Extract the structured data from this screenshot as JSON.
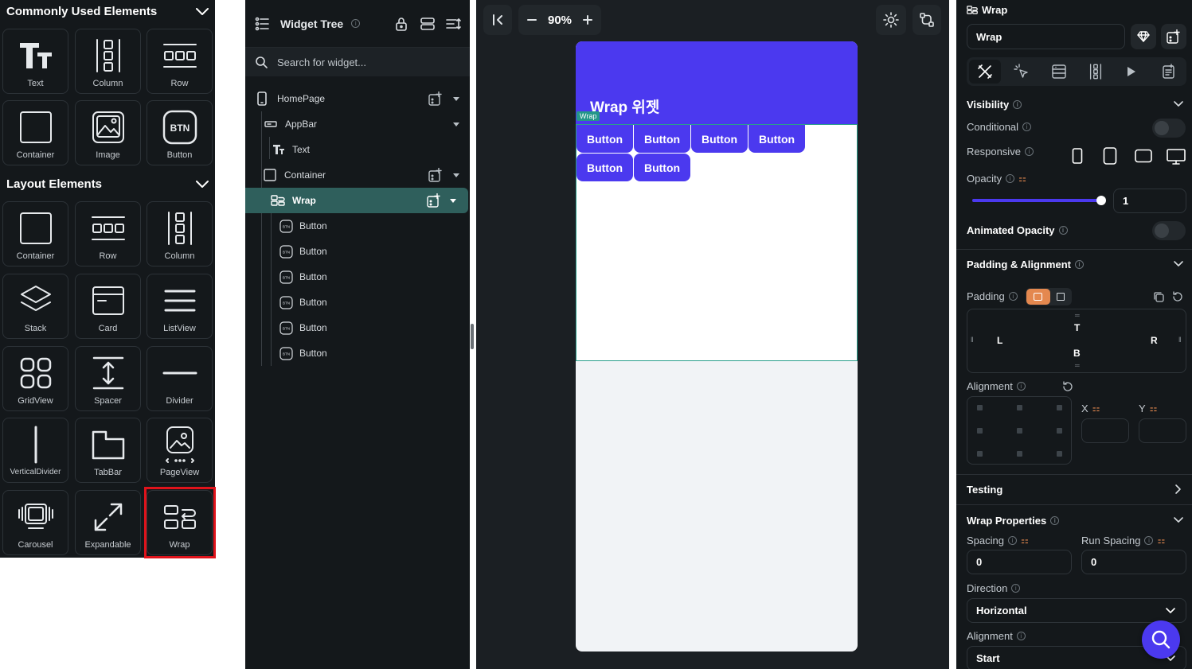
{
  "palette": {
    "common_title": "Commonly Used Elements",
    "layout_title": "Layout Elements",
    "common_items": [
      {
        "label": "Text",
        "icon": "text-icon"
      },
      {
        "label": "Column",
        "icon": "column-icon"
      },
      {
        "label": "Row",
        "icon": "row-icon"
      },
      {
        "label": "Container",
        "icon": "container-icon"
      },
      {
        "label": "Image",
        "icon": "image-icon"
      },
      {
        "label": "Button",
        "icon": "button-icon",
        "badge": "BTN"
      }
    ],
    "layout_items": [
      {
        "label": "Container",
        "icon": "container-icon"
      },
      {
        "label": "Row",
        "icon": "row-icon"
      },
      {
        "label": "Column",
        "icon": "column-icon"
      },
      {
        "label": "Stack",
        "icon": "stack-icon"
      },
      {
        "label": "Card",
        "icon": "card-icon"
      },
      {
        "label": "ListView",
        "icon": "listview-icon"
      },
      {
        "label": "GridView",
        "icon": "gridview-icon"
      },
      {
        "label": "Spacer",
        "icon": "spacer-icon"
      },
      {
        "label": "Divider",
        "icon": "divider-icon"
      },
      {
        "label": "VerticalDivider",
        "icon": "vertical-divider-icon"
      },
      {
        "label": "TabBar",
        "icon": "tabbar-icon"
      },
      {
        "label": "PageView",
        "icon": "pageview-icon"
      },
      {
        "label": "Carousel",
        "icon": "carousel-icon"
      },
      {
        "label": "Expandable",
        "icon": "expandable-icon"
      },
      {
        "label": "Wrap",
        "icon": "wrap-icon"
      }
    ],
    "highlight_color": "#e0131b"
  },
  "tree": {
    "title": "Widget Tree",
    "search_placeholder": "Search for widget...",
    "nodes": [
      {
        "label": "HomePage",
        "icon": "phone-icon"
      },
      {
        "label": "AppBar",
        "icon": "appbar-icon"
      },
      {
        "label": "Text",
        "icon": "text-icon"
      },
      {
        "label": "Container",
        "icon": "container-icon"
      },
      {
        "label": "Wrap",
        "icon": "wrap-icon",
        "selected": true
      },
      {
        "label": "Button",
        "icon": "button-icon"
      },
      {
        "label": "Button",
        "icon": "button-icon"
      },
      {
        "label": "Button",
        "icon": "button-icon"
      },
      {
        "label": "Button",
        "icon": "button-icon"
      },
      {
        "label": "Button",
        "icon": "button-icon"
      },
      {
        "label": "Button",
        "icon": "button-icon"
      }
    ],
    "selected_color": "#2f5f5c"
  },
  "canvas": {
    "zoom": "90%",
    "appbar_title": "Wrap 위젯",
    "wrap_badge": "Wrap",
    "buttons": [
      "Button",
      "Button",
      "Button",
      "Button",
      "Button",
      "Button"
    ],
    "accent": "#4b39ef"
  },
  "props": {
    "header_title": "Wrap",
    "name_value": "Wrap",
    "visibility": {
      "title": "Visibility",
      "conditional": "Conditional",
      "responsive": "Responsive",
      "opacity": "Opacity",
      "opacity_value": "1",
      "opacity_level": 1,
      "animated_opacity": "Animated Opacity"
    },
    "padding": {
      "title": "Padding & Alignment",
      "padding_label": "Padding",
      "t": "T",
      "l": "L",
      "r": "R",
      "b": "B",
      "alignment_label": "Alignment",
      "x": "X",
      "y": "Y"
    },
    "testing": "Testing",
    "wrap": {
      "title": "Wrap Properties",
      "spacing": "Spacing",
      "spacing_value": "0",
      "run_spacing": "Run Spacing",
      "run_spacing_value": "0",
      "direction": "Direction",
      "direction_value": "Horizontal",
      "alignment": "Alignment",
      "alignment_value": "Start"
    }
  }
}
